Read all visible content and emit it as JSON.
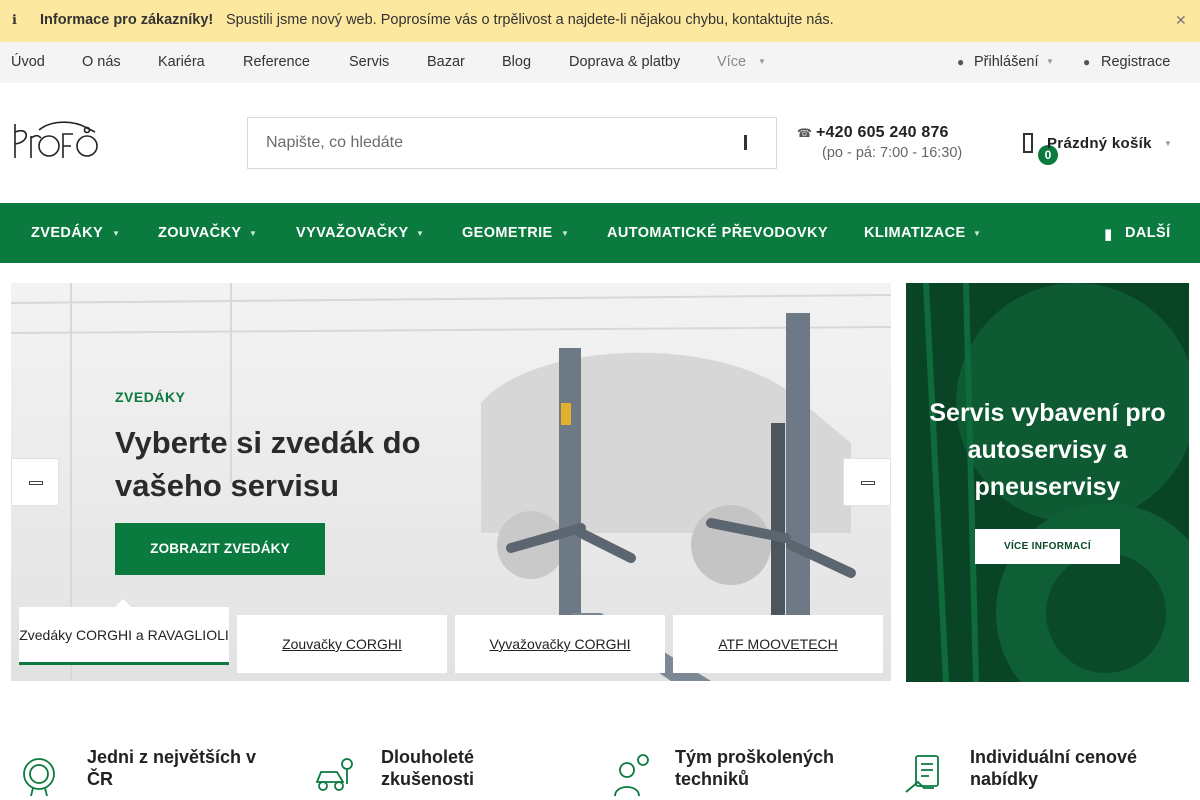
{
  "info_bar": {
    "icon": "info-icon",
    "title": "Informace pro zákazníky!",
    "message": "Spustili jsme nový web. Poprosíme vás o trpělivost a najdete-li nějakou chybu, kontaktujte nás.",
    "close_icon": "close-icon"
  },
  "top_nav": {
    "items": [
      "Úvod",
      "O nás",
      "Kariéra",
      "Reference",
      "Servis",
      "Bazar",
      "Blog",
      "Doprava & platby"
    ],
    "more_label": "Více",
    "login_label": "Přihlášení",
    "register_label": "Registrace"
  },
  "header": {
    "logo_alt": "PROFO",
    "search_placeholder": "Napište, co hledáte",
    "phone": "+420 605 240 876",
    "hours": "(po - pá: 7:00 - 16:30)",
    "cart_count": "0",
    "cart_label": "Prázdný košík"
  },
  "category_nav": {
    "items": [
      "ZVEDÁKY",
      "ZOUVAČKY",
      "VYVAŽOVAČKY",
      "GEOMETRIE",
      "AUTOMATICKÉ PŘEVODOVKY",
      "KLIMATIZACE"
    ],
    "more_label": "DALŠÍ"
  },
  "hero": {
    "kicker": "ZVEDÁKY",
    "headline": "Vyberte si zvedák do vašeho servisu",
    "cta": "ZOBRAZIT ZVEDÁKY",
    "tabs": [
      "Zvedáky CORGHI a RAVAGLIOLI",
      "Zouvačky CORGHI",
      "Vyvažovačky CORGHI",
      "ATF MOOVETECH"
    ]
  },
  "side_banner": {
    "text": "Servis vybavení pro autoservisy a pneuservisy",
    "button": "VÍCE INFORMACÍ"
  },
  "features": [
    {
      "icon": "award-badge-icon",
      "text": "Jedni z největších v ČR"
    },
    {
      "icon": "car-repair-icon",
      "text": "Dlouholeté zkušenosti"
    },
    {
      "icon": "technician-icon",
      "text": "Tým proškolených techniků"
    },
    {
      "icon": "contract-icon",
      "text": "Individuální cenové nabídky"
    }
  ],
  "colors": {
    "brand_green": "#0b7a3f",
    "info_bar": "#fde8a0",
    "banner_dark_green": "#0b4a29"
  }
}
